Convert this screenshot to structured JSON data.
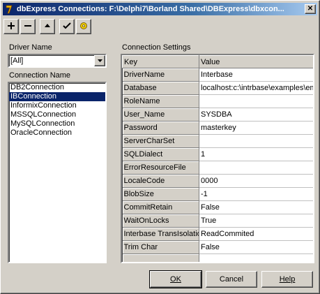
{
  "window": {
    "title": "dbExpress Connections: F:\\Delphi7\\Borland Shared\\DBExpress\\dbxcon...",
    "icons": {
      "app": "delphi-app-icon",
      "close": "close-icon"
    }
  },
  "toolbar": {
    "buttons": [
      {
        "icon": "add-icon"
      },
      {
        "icon": "remove-icon"
      },
      {
        "icon": "move-up-icon"
      },
      {
        "icon": "test-connection-icon"
      },
      {
        "icon": "driver-settings-icon"
      }
    ]
  },
  "driver": {
    "label": "Driver Name",
    "selected": "[All]"
  },
  "connections": {
    "label": "Connection Name",
    "items": [
      "DB2Connection",
      "IBConnection",
      "InformixConnection",
      "MSSQLConnection",
      "MySQLConnection",
      "OracleConnection"
    ],
    "selected_index": 1
  },
  "settings": {
    "label": "Connection Settings",
    "columns": [
      "Key",
      "Value"
    ],
    "rows": [
      {
        "key": "DriverName",
        "value": "Interbase"
      },
      {
        "key": "Database",
        "value": "localhost:c:\\intrbase\\examples\\em"
      },
      {
        "key": "RoleName",
        "value": ""
      },
      {
        "key": "User_Name",
        "value": "SYSDBA"
      },
      {
        "key": "Password",
        "value": "masterkey"
      },
      {
        "key": "ServerCharSet",
        "value": ""
      },
      {
        "key": "SQLDialect",
        "value": "1"
      },
      {
        "key": "ErrorResourceFile",
        "value": ""
      },
      {
        "key": "LocaleCode",
        "value": "0000"
      },
      {
        "key": "BlobSize",
        "value": "-1"
      },
      {
        "key": "CommitRetain",
        "value": "False"
      },
      {
        "key": "WaitOnLocks",
        "value": "True"
      },
      {
        "key": "Interbase TransIsolation",
        "value": "ReadCommited"
      },
      {
        "key": "Trim Char",
        "value": "False"
      }
    ]
  },
  "buttons": {
    "ok": "OK",
    "cancel": "Cancel",
    "help": "Help"
  },
  "colors": {
    "titlebar": "#0a246a",
    "selection": "#0a246a",
    "face": "#d4d0c8"
  }
}
